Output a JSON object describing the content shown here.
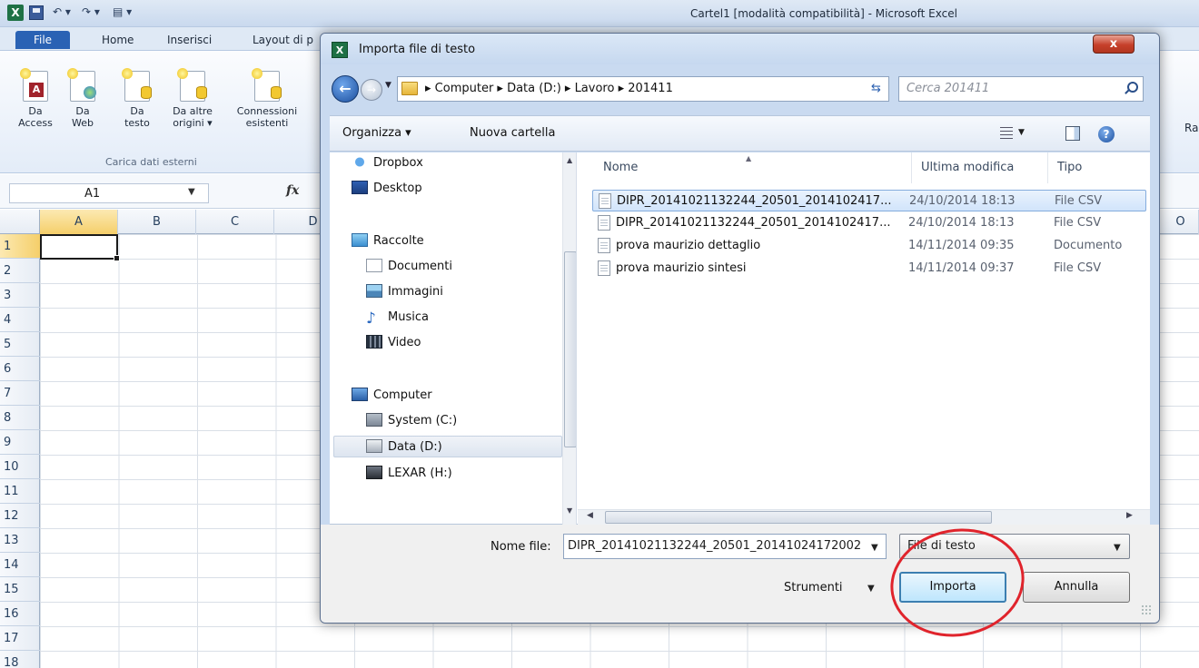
{
  "excel": {
    "title": "Cartel1  [modalità compatibilità]  -  Microsoft Excel",
    "tabs": [
      "File",
      "Home",
      "Inserisci",
      "Layout di p"
    ],
    "ribbon_buttons": [
      {
        "line1": "Da",
        "line2": "Access"
      },
      {
        "line1": "Da",
        "line2": "Web"
      },
      {
        "line1": "Da",
        "line2": "testo"
      },
      {
        "line1": "Da altre",
        "line2": "origini ▾"
      },
      {
        "line1": "Connessioni",
        "line2": "esistenti"
      }
    ],
    "group_label": "Carica dati esterni",
    "ribbon_right_label": "Ra",
    "name_box": "A1",
    "fx": "fx",
    "columns": [
      "A",
      "B",
      "C",
      "D",
      "O"
    ],
    "rows": [
      "1",
      "2",
      "3",
      "4",
      "5",
      "6",
      "7",
      "8",
      "9",
      "10",
      "11",
      "12",
      "13",
      "14",
      "15",
      "16",
      "17",
      "18"
    ]
  },
  "dialog": {
    "title": "Importa file di testo",
    "close_label": "x",
    "path": "▸  Computer  ▸  Data (D:)  ▸  Lavoro  ▸  201411",
    "search_placeholder": "Cerca 201411",
    "toolbar": {
      "organize": "Organizza ▾",
      "new_folder": "Nuova cartella"
    },
    "nav_items": {
      "dropbox": "Dropbox",
      "desktop": "Desktop",
      "libraries": "Raccolte",
      "documents": "Documenti",
      "images": "Immagini",
      "music": "Musica",
      "video": "Video",
      "computer": "Computer",
      "system": "System (C:)",
      "data": "Data (D:)",
      "lexar": "LEXAR (H:)"
    },
    "columns": {
      "name": "Nome",
      "modified": "Ultima modifica",
      "type": "Tipo"
    },
    "files": [
      {
        "name": "DIPR_20141021132244_20501_2014102417...",
        "date": "24/10/2014 18:13",
        "type": "File CSV"
      },
      {
        "name": "DIPR_20141021132244_20501_2014102417...",
        "date": "24/10/2014 18:13",
        "type": "File CSV"
      },
      {
        "name": "prova maurizio dettaglio",
        "date": "14/11/2014 09:35",
        "type": "Documento"
      },
      {
        "name": "prova maurizio sintesi",
        "date": "14/11/2014 09:37",
        "type": "File CSV"
      }
    ],
    "filename_label": "Nome file:",
    "filename_value": "DIPR_20141021132244_20501_20141024172002",
    "filetype_value": "File di testo",
    "tools_label": "Strumenti",
    "import_label": "Importa",
    "cancel_label": "Annulla"
  },
  "colors": {
    "annotation": "#e0242c",
    "selection": "#d1e4fb",
    "excel_green": "#1e7145"
  }
}
